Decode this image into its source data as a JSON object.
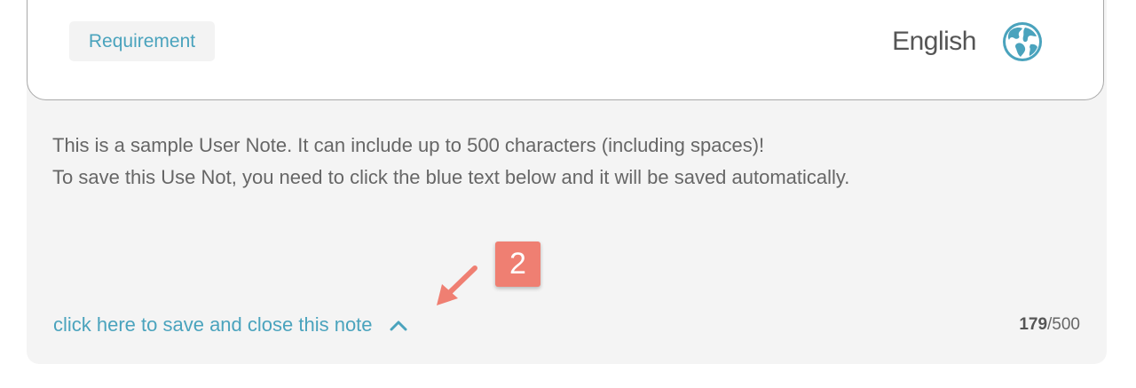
{
  "card": {
    "tag_label": "Requirement",
    "language_label": "English",
    "language_icon": "globe-icon"
  },
  "note": {
    "lines": [
      "This is a sample User Note. It can include up to 500 characters (including spaces)!",
      "To save this Use Not, you need to click the blue text below and it will be saved automatically."
    ],
    "save_link_label": "click here to save and close this note",
    "save_link_icon": "chevron-up-icon",
    "char_count": "179",
    "char_limit": "/500"
  },
  "annotation": {
    "step_number": "2",
    "badge_color": "#ef7f72",
    "arrow_icon": "pointer-arrow-icon"
  },
  "colors": {
    "accent": "#4aa3bd",
    "panel_background": "#f4f4f4",
    "text": "#666666"
  }
}
